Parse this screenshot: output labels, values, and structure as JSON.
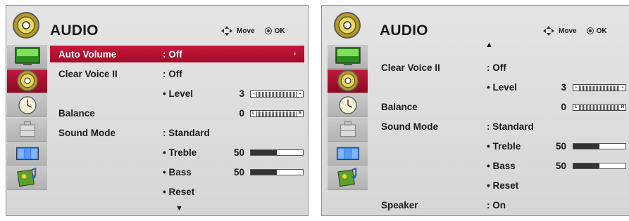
{
  "left_panel": {
    "title": "AUDIO",
    "hint_move": "Move",
    "hint_ok": "OK",
    "rows": {
      "auto_volume": {
        "label": "Auto Volume",
        "value": ": Off"
      },
      "clear_voice": {
        "label": "Clear Voice II",
        "value": ": Off"
      },
      "level": {
        "label": "• Level",
        "value": "3",
        "fraction": 0.35
      },
      "balance": {
        "label": "Balance",
        "value": "0",
        "fraction": 0.5,
        "left": "L",
        "right": "R"
      },
      "sound_mode": {
        "label": "Sound Mode",
        "value": ": Standard"
      },
      "treble": {
        "label": "• Treble",
        "value": "50",
        "fraction": 0.5
      },
      "bass": {
        "label": "• Bass",
        "value": "50",
        "fraction": 0.5
      },
      "reset": {
        "label": "• Reset"
      }
    },
    "arrow_down": "▼",
    "arrow_right": "›"
  },
  "right_panel": {
    "title": "AUDIO",
    "hint_move": "Move",
    "hint_ok": "OK",
    "arrow_up": "▲",
    "rows": {
      "clear_voice": {
        "label": "Clear Voice II",
        "value": ": Off"
      },
      "level": {
        "label": "• Level",
        "value": "3",
        "fraction": 0.35
      },
      "balance": {
        "label": "Balance",
        "value": "0",
        "fraction": 0.5,
        "left": "L",
        "right": "R"
      },
      "sound_mode": {
        "label": "Sound Mode",
        "value": ": Standard"
      },
      "treble": {
        "label": "• Treble",
        "value": "50",
        "fraction": 0.5
      },
      "bass": {
        "label": "• Bass",
        "value": "50",
        "fraction": 0.5
      },
      "reset": {
        "label": "• Reset"
      },
      "speaker": {
        "label": "Speaker",
        "value": ": On"
      }
    }
  },
  "sidebar_icons": [
    "picture-icon",
    "speaker-icon",
    "clock-icon",
    "toolbox-icon",
    "screen-icon",
    "media-icon"
  ],
  "colors": {
    "highlight": "#b8102f",
    "panel_bg": "#dedede"
  }
}
